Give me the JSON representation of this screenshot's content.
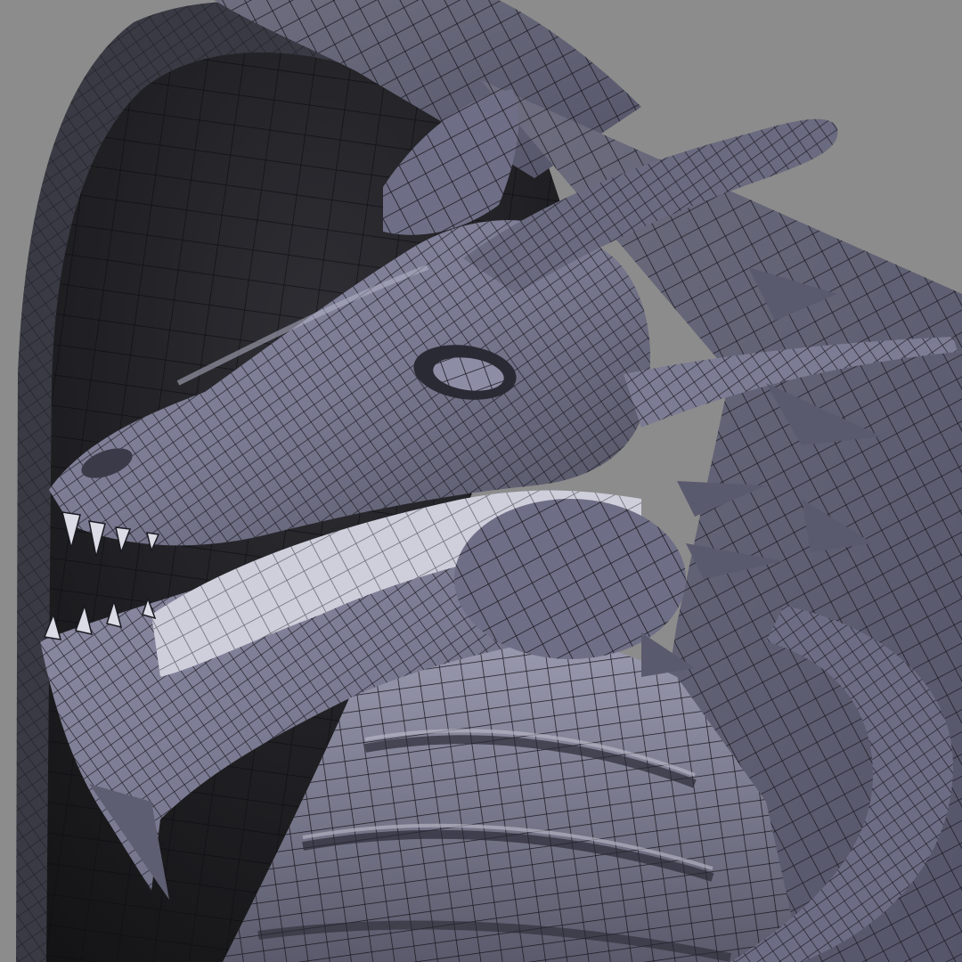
{
  "viewport": {
    "background_color": "#8c8c8c",
    "surface_color": "#7a7a90",
    "wire_color": "#1a1a22",
    "shadow_color": "#151518",
    "highlight_color": "#c4c4d6"
  }
}
